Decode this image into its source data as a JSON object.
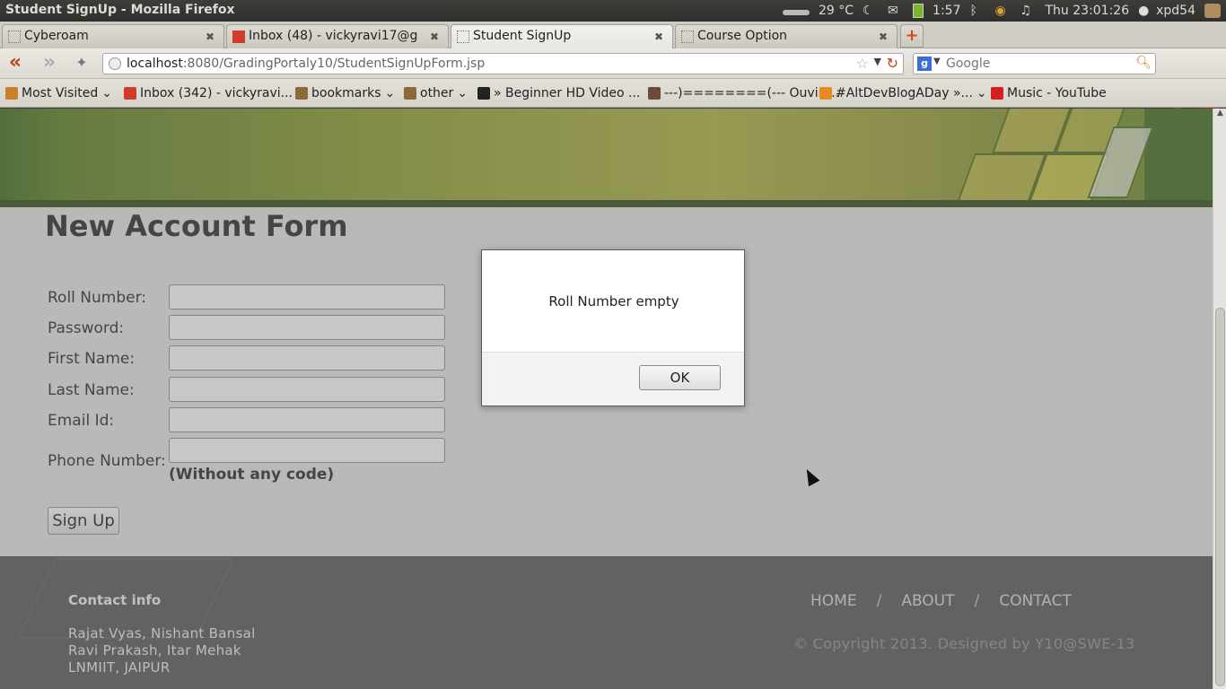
{
  "window": {
    "title": "Student SignUp - Mozilla Firefox"
  },
  "tray": {
    "weather": "29 °C",
    "battery": "1:57",
    "clock": "Thu 23:01:26",
    "user": "xpd54"
  },
  "tabs": [
    {
      "label": "Cyberoam",
      "active": false
    },
    {
      "label": "Inbox (48) - vickyravi17@g...",
      "active": false
    },
    {
      "label": "Student SignUp",
      "active": true
    },
    {
      "label": "Course Option",
      "active": false
    }
  ],
  "navbar": {
    "url_host": "localhost",
    "url_rest": ":8080/GradingPortaly10/StudentSignUpForm.jsp",
    "search_placeholder": "Google",
    "search_engine_letter": "g"
  },
  "bookmarks": [
    {
      "label": "Most Visited",
      "dropdown": true,
      "icon": "folder-icon"
    },
    {
      "label": "Inbox (342) - vickyravi...",
      "dropdown": false,
      "icon": "gmail-icon"
    },
    {
      "label": "bookmarks",
      "dropdown": true,
      "icon": "folder-icon"
    },
    {
      "label": "other",
      "dropdown": true,
      "icon": "folder-icon"
    },
    {
      "label": "» Beginner HD Video ...",
      "dropdown": false,
      "icon": "video-icon"
    },
    {
      "label": "---)========(--- Ouvir ...",
      "dropdown": false,
      "icon": "site-icon"
    },
    {
      "label": "#AltDevBlogADay »...",
      "dropdown": true,
      "icon": "rss-icon"
    },
    {
      "label": "Music - YouTube",
      "dropdown": false,
      "icon": "youtube-icon"
    }
  ],
  "form": {
    "heading": "New Account Form",
    "fields": [
      {
        "label": "Roll Number:",
        "value": ""
      },
      {
        "label": "Password:",
        "value": ""
      },
      {
        "label": "First Name:",
        "value": ""
      },
      {
        "label": "Last Name:",
        "value": ""
      },
      {
        "label": "Email Id:",
        "value": ""
      },
      {
        "label": "Phone Number:",
        "value": ""
      }
    ],
    "phone_hint": "(Without any code)",
    "submit_label": "Sign Up"
  },
  "footer": {
    "contact_title": "Contact info",
    "address_lines": [
      "Rajat Vyas, Nishant Bansal",
      "Ravi Prakash, Itar Mehak",
      "LNMIIT, JAIPUR"
    ],
    "links": [
      "HOME",
      "ABOUT",
      "CONTACT"
    ],
    "separator": "/",
    "copyright": "© Copyright 2013. Designed by Y10@SWE-13"
  },
  "dialog": {
    "message": "Roll Number empty",
    "ok_label": "OK"
  },
  "colors": {
    "accent": "#b5421a",
    "banner_green": "#6a8a24",
    "footer_bg": "#575757"
  }
}
